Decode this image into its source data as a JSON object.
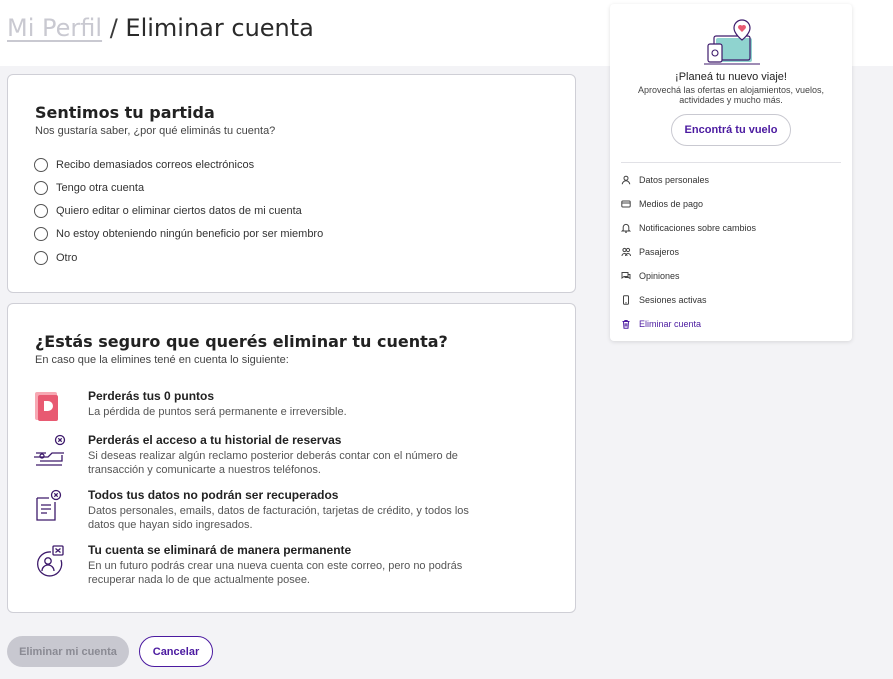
{
  "breadcrumb": {
    "parent": "Mi Perfil",
    "separator": "/",
    "current": "Eliminar cuenta"
  },
  "reasons": {
    "title": "Sentimos tu partida",
    "subtitle": "Nos gustaría saber, ¿por qué eliminás tu cuenta?",
    "options": [
      "Recibo demasiados correos electrónicos",
      "Tengo otra cuenta",
      "Quiero editar o eliminar ciertos datos de mi cuenta",
      "No estoy obteniendo ningún beneficio por ser miembro",
      "Otro"
    ]
  },
  "confirm": {
    "title": "¿Estás seguro que querés eliminar tu cuenta?",
    "subtitle": "En caso que la elimines tené en cuenta lo siguiente:",
    "items": [
      {
        "icon": "points-card-icon",
        "title": "Perderás tus 0 puntos",
        "desc": "La pérdida de puntos será permanente e irreversible."
      },
      {
        "icon": "booking-history-icon",
        "title": "Perderás el acceso a tu historial de reservas",
        "desc": "Si deseas realizar algún reclamo posterior deberás contar con el número de transacción y comunicarte a nuestros teléfonos."
      },
      {
        "icon": "data-document-icon",
        "title": "Todos tus datos no podrán ser recuperados",
        "desc": "Datos personales, emails, datos de facturación, tarjetas de crédito, y todos los datos que hayan sido ingresados."
      },
      {
        "icon": "user-delete-icon",
        "title": "Tu cuenta se eliminará de manera permanente",
        "desc": "En un futuro podrás crear una nueva cuenta con este correo, pero no podrás recuperar nada lo de que actualmente posee."
      }
    ]
  },
  "actions": {
    "delete_label": "Eliminar mi cuenta",
    "cancel_label": "Cancelar"
  },
  "promo": {
    "title": "¡Planeá tu nuevo viaje!",
    "text": "Aprovechá las ofertas en alojamientos, vuelos, actividades y mucho más.",
    "button_label": "Encontrá tu vuelo"
  },
  "menu": [
    {
      "icon": "user-icon",
      "label": "Datos personales"
    },
    {
      "icon": "card-icon",
      "label": "Medios de pago"
    },
    {
      "icon": "bell-icon",
      "label": "Notificaciones sobre cambios"
    },
    {
      "icon": "passengers-icon",
      "label": "Pasajeros"
    },
    {
      "icon": "chat-icon",
      "label": "Opiniones"
    },
    {
      "icon": "phone-icon",
      "label": "Sesiones activas"
    },
    {
      "icon": "trash-icon",
      "label": "Eliminar cuenta"
    }
  ],
  "colors": {
    "accent": "#4b1aa0",
    "brand_pink": "#e85a72",
    "disabled": "#c8c8d0"
  }
}
